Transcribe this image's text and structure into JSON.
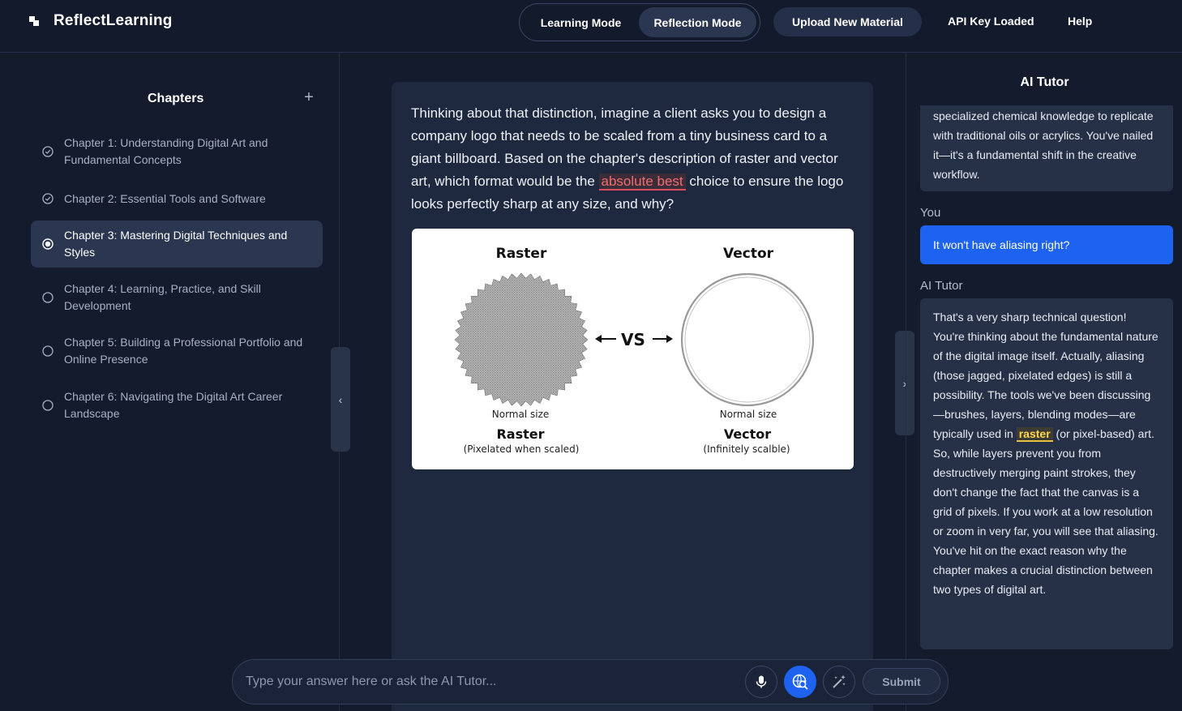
{
  "header": {
    "brand": "ReflectLearning",
    "modes": [
      "Learning Mode",
      "Reflection Mode"
    ],
    "active_mode": "Reflection Mode",
    "upload_label": "Upload New Material",
    "api_status": "API Key Loaded",
    "help_label": "Help"
  },
  "sidebar": {
    "title": "Chapters",
    "add_icon": "plus-icon",
    "chapters": [
      {
        "label": "Chapter 1: Understanding Digital Art and Fundamental Concepts",
        "status": "completed"
      },
      {
        "label": "Chapter 2: Essential Tools and Software",
        "status": "completed"
      },
      {
        "label": "Chapter 3: Mastering Digital Techniques and Styles",
        "status": "current"
      },
      {
        "label": "Chapter 4: Learning, Practice, and Skill Development",
        "status": "pending"
      },
      {
        "label": "Chapter 5: Building a Professional Portfolio and Online Presence",
        "status": "pending"
      },
      {
        "label": "Chapter 6: Navigating the Digital Art Career Landscape",
        "status": "pending"
      }
    ]
  },
  "main": {
    "prompt_before": "Thinking about that distinction, imagine a client asks you to design a company logo that needs to be scaled from a tiny business card to a giant billboard. Based on the chapter's description of raster and vector art, which format would be the ",
    "prompt_highlight": "absolute best",
    "prompt_after": " choice to ensure the logo looks perfectly sharp at any size, and why?",
    "figure": {
      "left_title": "Raster",
      "right_title": "Vector",
      "vs_label": "VS",
      "left_size_label": "Normal size",
      "right_size_label": "Normal size",
      "left_caption_title": "Raster",
      "left_caption_sub": "(Pixelated when scaled)",
      "right_caption_title": "Vector",
      "right_caption_sub": "(Infinitely scalble)"
    }
  },
  "tutor": {
    "title": "AI Tutor",
    "messages": [
      {
        "role": "ai",
        "text": "specialized chemical knowledge to replicate with traditional oils or acrylics. You've nailed it—it's a fundamental shift in the creative workflow."
      },
      {
        "role": "user",
        "label": "You",
        "text": "It won't have aliasing right?"
      },
      {
        "role": "ai",
        "label": "AI Tutor",
        "text_before": "That's a very sharp technical question! You're thinking about the fundamental nature of the digital image itself. Actually, aliasing (those jagged, pixelated edges) is still a possibility. The tools we've been discussing—brushes, layers, blending modes—are typically used in ",
        "highlight": "raster",
        "text_after": " (or pixel-based) art. So, while layers prevent you from destructively merging paint strokes, they don't change the fact that the canvas is a grid of pixels. If you work at a low resolution or zoom in very far, you will see that aliasing. You've hit on the exact reason why the chapter makes a crucial distinction between two types of digital art."
      }
    ]
  },
  "input": {
    "placeholder": "Type your answer here or ask the AI Tutor...",
    "value": "",
    "mic_icon": "microphone-icon",
    "search_icon": "web-search-icon",
    "magic_icon": "magic-wand-icon",
    "submit_label": "Submit"
  },
  "colors": {
    "background": "#141b2d",
    "panel": "#1e2940",
    "accent_blue": "#1d63f0",
    "highlight_red": "#f26d6d",
    "highlight_yellow": "#ffd84a"
  }
}
